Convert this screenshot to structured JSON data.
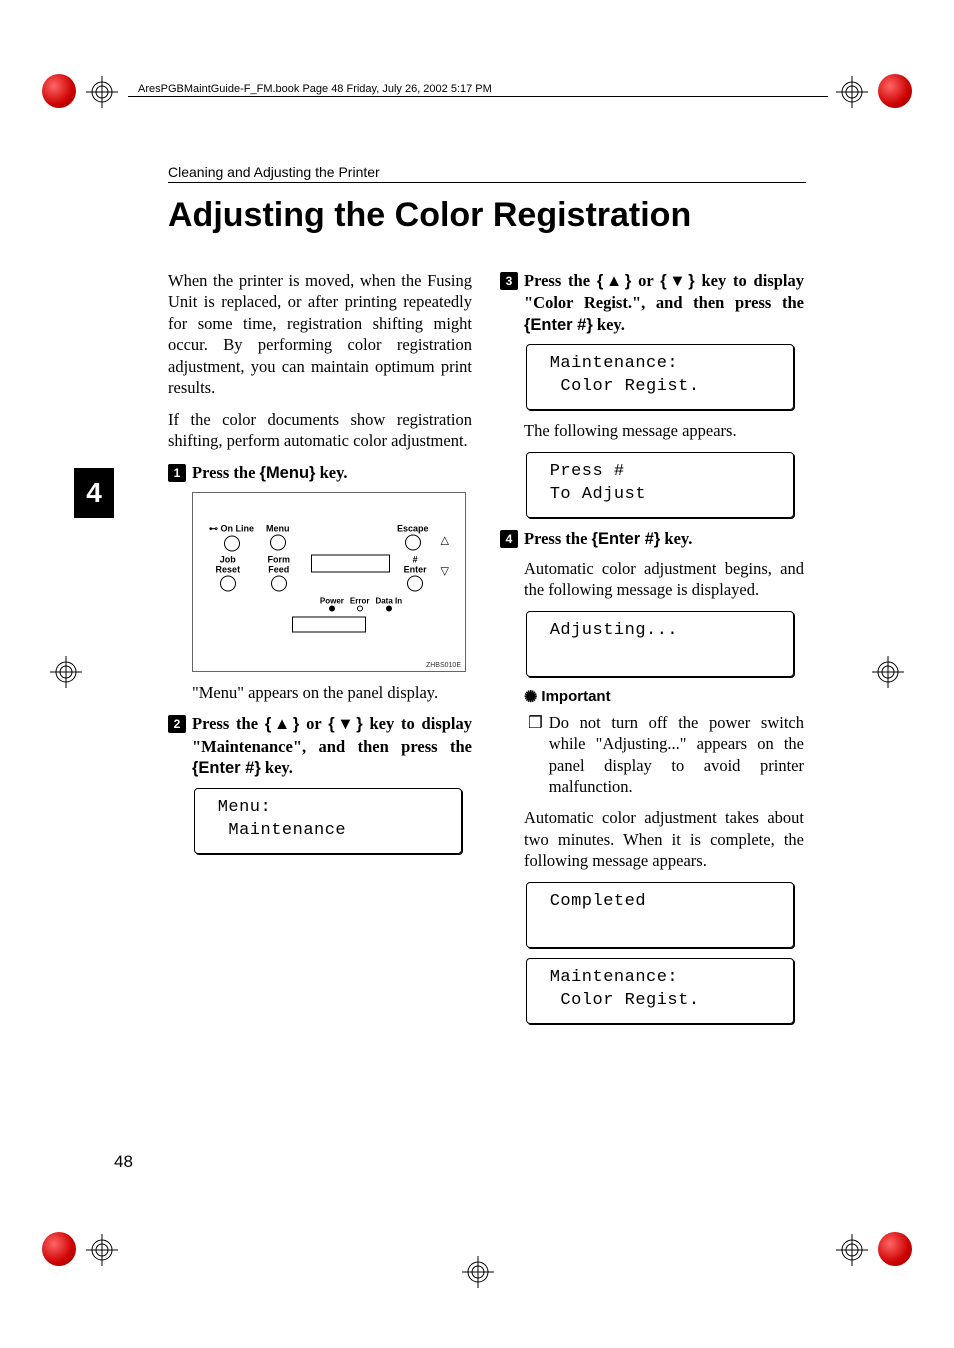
{
  "meta": {
    "file_header": "AresPGBMaintGuide-F_FM.book  Page 48  Friday, July 26, 2002  5:17 PM",
    "section_header": "Cleaning and Adjusting the Printer",
    "main_title": "Adjusting the Color Registration",
    "chapter_number": "4",
    "page_number": "48",
    "illus_caption": "ZHBS010E"
  },
  "left": {
    "para1": "When the printer is moved, when the Fusing Unit is replaced, or after printing repeatedly for some time, registration shifting might occur. By performing color registration adjustment, you can maintain optimum print results.",
    "para2": "If the color documents show registration shifting, perform automatic color adjustment.",
    "step1_pre": "Press the ",
    "step1_key": "Menu",
    "step1_post": " key.",
    "panel": {
      "online": "On Line",
      "menu": "Menu",
      "escape": "Escape",
      "jobreset": "Job Reset",
      "formfeed": "Form Feed",
      "enter": "# Enter",
      "power": "Power",
      "error": "Error",
      "datain": "Data In"
    },
    "para3": "\"Menu\" appears on the panel display.",
    "step2_pre": "Press the ",
    "step2_mid": " or ",
    "step2_post1": " key to display \"Maintenance\", and then press the ",
    "step2_key": "Enter #",
    "step2_post2": " key.",
    "lcd1_line1": " Menu:",
    "lcd1_line2": "  Maintenance"
  },
  "right": {
    "step3_pre": "Press the ",
    "step3_mid": " or ",
    "step3_post1": " key to display \"Color Regist.\", and then press the ",
    "step3_key": "Enter #",
    "step3_post2": " key.",
    "lcd2_line1": " Maintenance:",
    "lcd2_line2": "  Color Regist.",
    "para1": "The following message appears.",
    "lcd3_line1": " Press #",
    "lcd3_line2": " To Adjust",
    "step4_pre": "Press the ",
    "step4_key": "Enter #",
    "step4_post": " key.",
    "para2": "Automatic color adjustment begins, and the following message is displayed.",
    "lcd4_line1": " Adjusting...",
    "important_label": "Important",
    "note1": "Do not turn off the power switch while \"Adjusting...\" appears on the panel display to avoid printer malfunction.",
    "para3": "Automatic color adjustment takes about two minutes. When it is complete, the following message appears.",
    "lcd5_line1": " Completed",
    "lcd6_line1": " Maintenance:",
    "lcd6_line2": "  Color Regist."
  }
}
